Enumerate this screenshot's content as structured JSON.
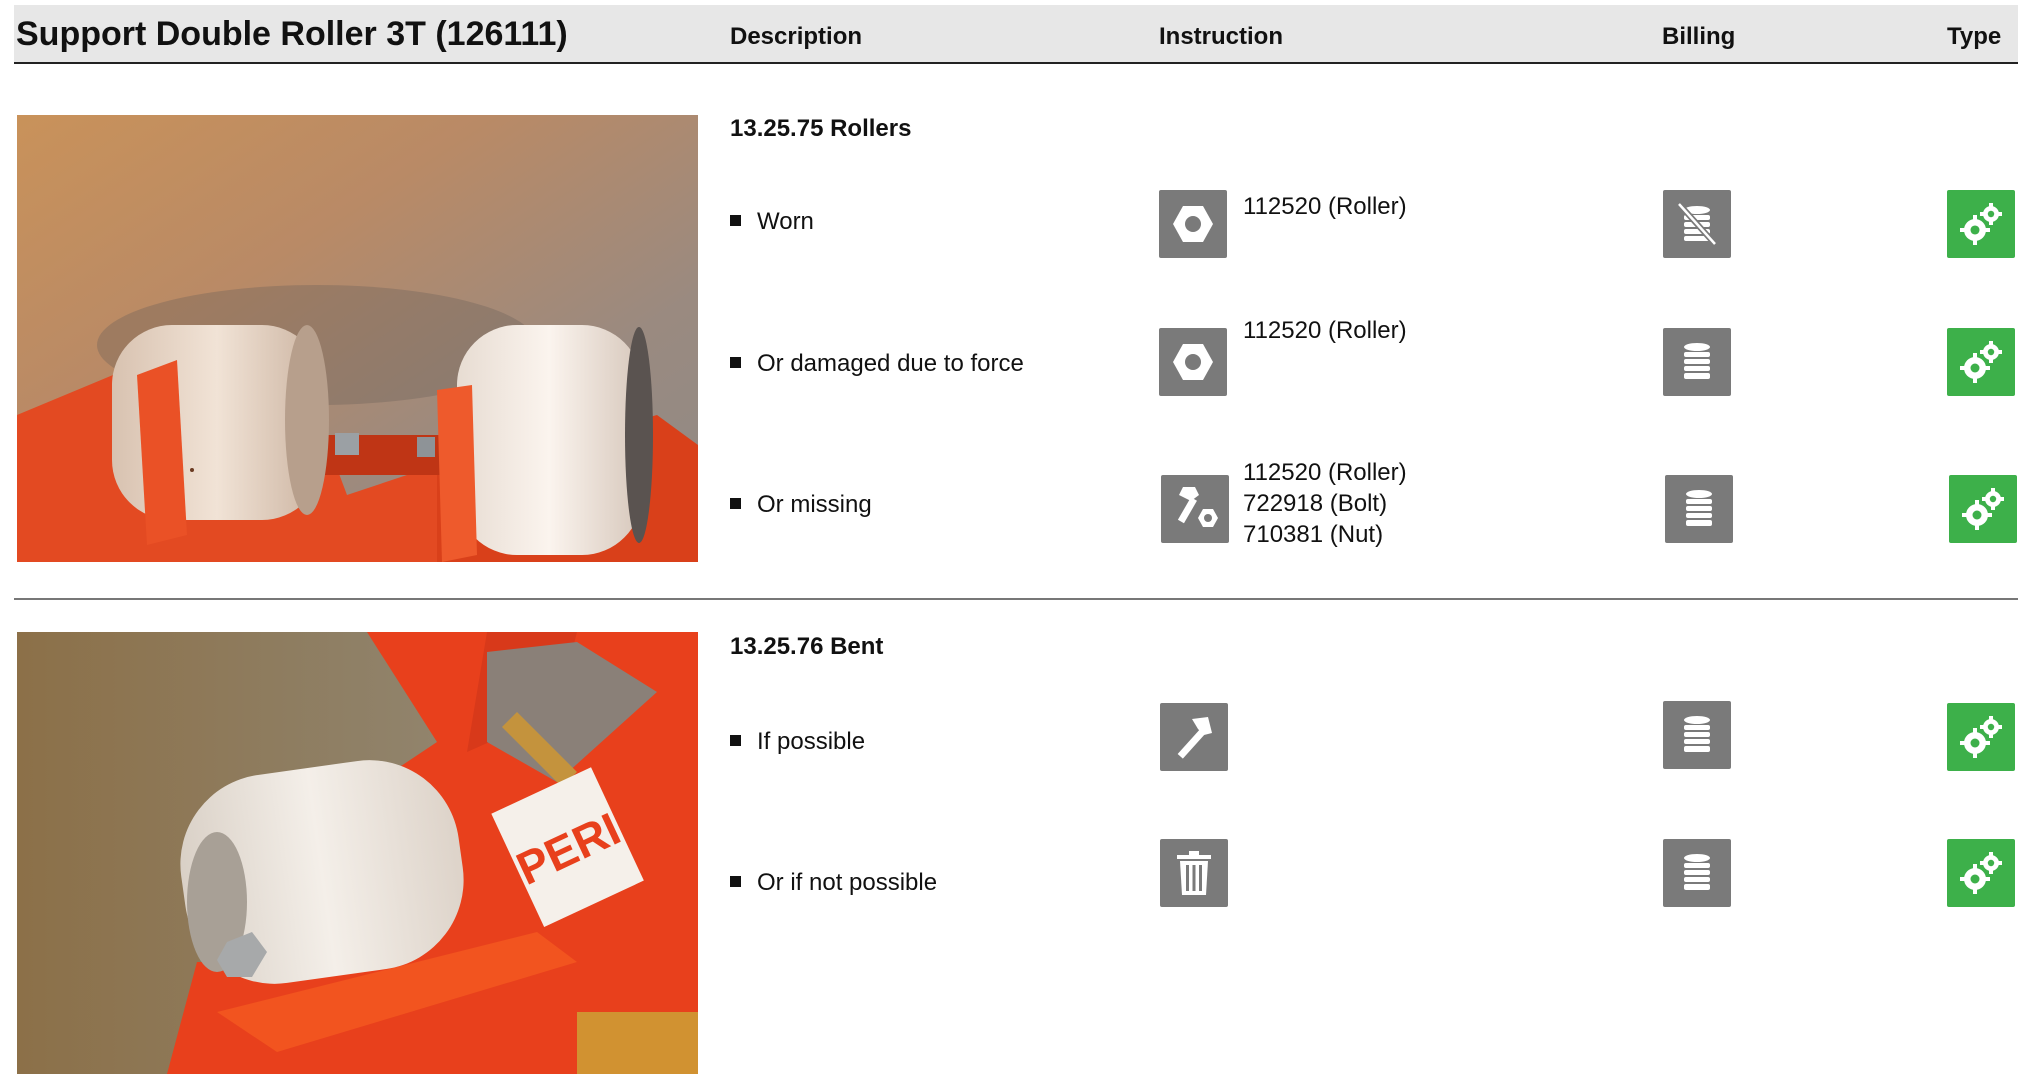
{
  "header": {
    "title": "Support Double Roller 3T (126111)",
    "col_description": "Description",
    "col_instruction": "Instruction",
    "col_billing": "Billing",
    "col_type": "Type"
  },
  "sections": [
    {
      "title": "13.25.75 Rollers",
      "photo_alt": "Support double roller with two white rollers on red frame",
      "items": [
        {
          "label": "Worn",
          "instruction_icon": "hex-nut-icon",
          "instruction_lines": [
            "112520 (Roller)"
          ],
          "billing_icon": "coin-stack-crossed-icon",
          "type_icon": "gears-icon"
        },
        {
          "label": "Or damaged due to force",
          "instruction_icon": "hex-nut-icon",
          "instruction_lines": [
            "112520 (Roller)"
          ],
          "billing_icon": "coin-stack-icon",
          "type_icon": "gears-icon"
        },
        {
          "label": "Or missing",
          "instruction_icon": "bolt-nut-icon",
          "instruction_lines": [
            "112520 (Roller)",
            "722918 (Bolt)",
            "710381 (Nut)"
          ],
          "billing_icon": "coin-stack-icon",
          "type_icon": "gears-icon"
        }
      ]
    },
    {
      "title": "13.25.76 Bent",
      "photo_alt": "Bent roller holder on red frame with PERI label",
      "photo_label": "PERI",
      "items": [
        {
          "label": "If possible",
          "instruction_icon": "hammer-icon",
          "instruction_lines": [],
          "billing_icon": "coin-stack-icon",
          "type_icon": "gears-icon"
        },
        {
          "label": "Or if not possible",
          "instruction_icon": "trash-icon",
          "instruction_lines": [],
          "billing_icon": "coin-stack-icon",
          "type_icon": "gears-icon"
        }
      ]
    }
  ],
  "colors": {
    "header_bg": "#e7e7e7",
    "icon_gray": "#7a7a7a",
    "icon_green": "#3db04a",
    "frame_red": "#e8401c"
  }
}
